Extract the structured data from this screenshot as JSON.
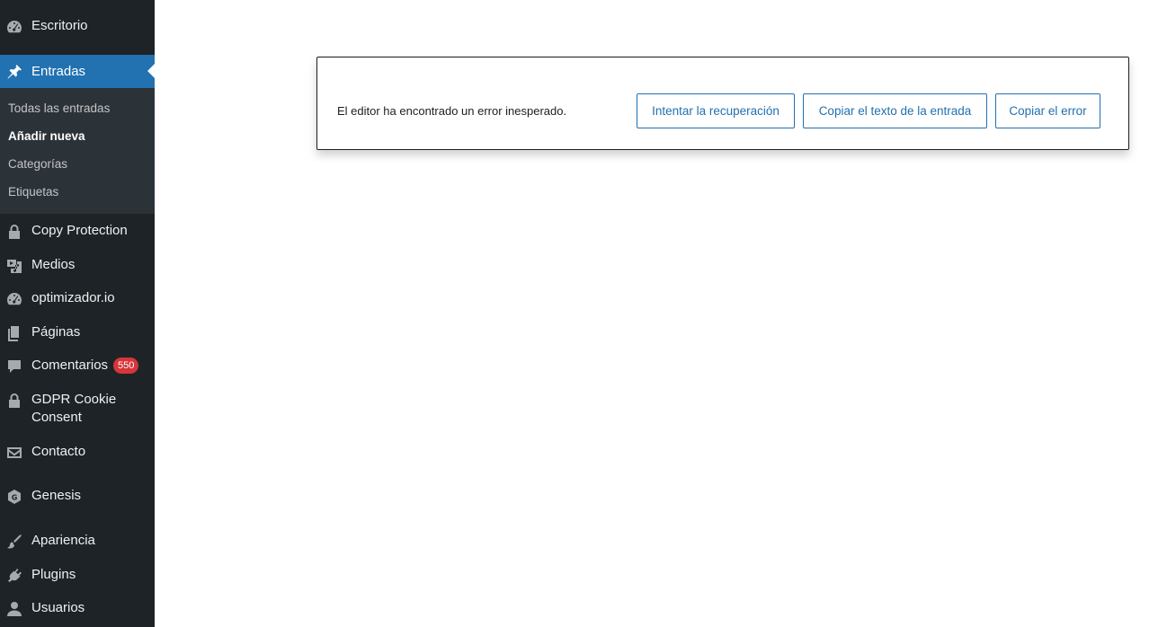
{
  "sidebar": {
    "items": [
      {
        "label": "Escritorio",
        "icon": "dashboard-icon"
      },
      {
        "label": "Entradas",
        "icon": "pin-icon"
      },
      {
        "label": "Copy Protection",
        "icon": "lock-icon"
      },
      {
        "label": "Medios",
        "icon": "media-icon"
      },
      {
        "label": "optimizador.io",
        "icon": "gauge-icon"
      },
      {
        "label": "Páginas",
        "icon": "pages-icon"
      },
      {
        "label": "Comentarios",
        "icon": "comment-icon",
        "badge": "550"
      },
      {
        "label": "GDPR Cookie",
        "label2": "Consent",
        "icon": "lock-icon"
      },
      {
        "label": "Contacto",
        "icon": "envelope-icon"
      },
      {
        "label": "Genesis",
        "icon": "genesis-icon"
      },
      {
        "label": "Apariencia",
        "icon": "brush-icon"
      },
      {
        "label": "Plugins",
        "icon": "plug-icon"
      },
      {
        "label": "Usuarios",
        "icon": "user-icon"
      }
    ],
    "submenu": [
      {
        "label": "Todas las entradas"
      },
      {
        "label": "Añadir nueva"
      },
      {
        "label": "Categorías"
      },
      {
        "label": "Etiquetas"
      }
    ]
  },
  "notice": {
    "message": "El editor ha encontrado un error inesperado.",
    "buttons": {
      "recover": "Intentar la recuperación",
      "copy_text": "Copiar el texto de la entrada",
      "copy_error": "Copiar el error"
    }
  },
  "colors": {
    "sidebar_bg": "#1d2327",
    "submenu_bg": "#2c3338",
    "active_bg": "#2271b1",
    "badge_bg": "#d63638",
    "button_color": "#2271b1"
  }
}
